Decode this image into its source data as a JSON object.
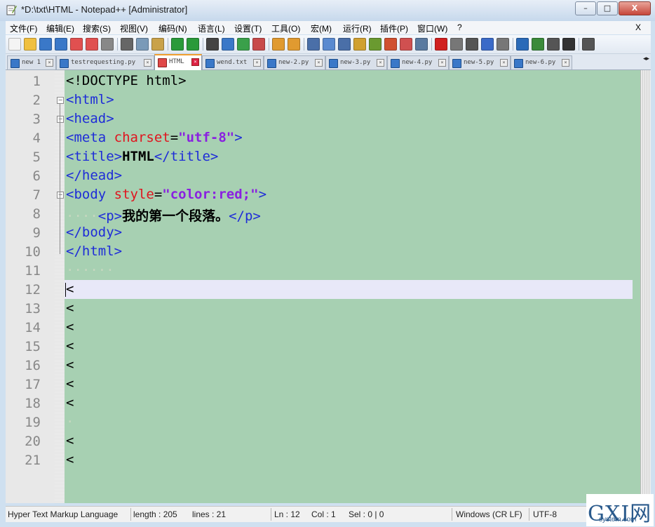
{
  "window": {
    "title": "*D:\\txt\\HTML - Notepad++ [Administrator]",
    "min_label": "–",
    "max_label": "□",
    "close_label": "X"
  },
  "menu": [
    "文件(F)",
    "编辑(E)",
    "搜索(S)",
    "视图(V)",
    "编码(N)",
    "语言(L)",
    "设置(T)",
    "工具(O)",
    "宏(M)",
    "运行(R)",
    "插件(P)",
    "窗口(W)",
    "?"
  ],
  "menu_close": "X",
  "toolbar_icons": [
    "new-file-icon",
    "open-file-icon",
    "save-icon",
    "save-all-icon",
    "close-icon",
    "close-all-icon",
    "print-icon",
    "cut-icon",
    "copy-icon",
    "paste-icon",
    "undo-icon",
    "redo-icon",
    "find-icon",
    "replace-icon",
    "zoom-in-icon",
    "zoom-out-icon",
    "sync-v-icon",
    "sync-h-icon",
    "wrap-icon",
    "show-all-chars-icon",
    "indent-guide-icon",
    "doc-map-icon",
    "function-list-icon",
    "folder-workspace-icon",
    "monitor-icon",
    "eye-icon",
    "record-macro-icon",
    "stop-macro-icon",
    "play-macro-icon",
    "run-macro-multiple-icon",
    "save-macro-icon",
    "download-icon",
    "list-icon",
    "list-alt-icon",
    "triangle-icon",
    "up-icon"
  ],
  "tabs": [
    {
      "label": "new 1",
      "active": false
    },
    {
      "label": "testrequesting.py",
      "active": false
    },
    {
      "label": "HTML",
      "active": true
    },
    {
      "label": "wend.txt",
      "active": false
    },
    {
      "label": "new-2.py",
      "active": false
    },
    {
      "label": "new-3.py",
      "active": false
    },
    {
      "label": "new-4.py",
      "active": false
    },
    {
      "label": "new-5.py",
      "active": false
    },
    {
      "label": "new-6.py",
      "active": false
    }
  ],
  "tab_scroll_label": "◂▸",
  "editor": {
    "current_line": 12,
    "lines": [
      {
        "n": "1",
        "tokens": [
          {
            "c": "plain",
            "t": "<!DOCTYPE html>"
          }
        ]
      },
      {
        "n": "2",
        "tokens": [
          {
            "c": "tag",
            "t": "<html>"
          }
        ]
      },
      {
        "n": "3",
        "tokens": [
          {
            "c": "tag",
            "t": "<head>"
          }
        ]
      },
      {
        "n": "4",
        "tokens": [
          {
            "c": "tag",
            "t": "<meta "
          },
          {
            "c": "attr",
            "t": "charset"
          },
          {
            "c": "plain",
            "t": "="
          },
          {
            "c": "val",
            "t": "\"utf-8\""
          },
          {
            "c": "tag",
            "t": ">"
          }
        ]
      },
      {
        "n": "5",
        "tokens": [
          {
            "c": "tag",
            "t": "<title>"
          },
          {
            "c": "txt",
            "t": "HTML"
          },
          {
            "c": "tag",
            "t": "</title>"
          }
        ]
      },
      {
        "n": "6",
        "tokens": [
          {
            "c": "tag",
            "t": "</head>"
          }
        ]
      },
      {
        "n": "7",
        "tokens": [
          {
            "c": "tag",
            "t": "<body "
          },
          {
            "c": "attr",
            "t": "style"
          },
          {
            "c": "plain",
            "t": "="
          },
          {
            "c": "val",
            "t": "\"color:red;\""
          },
          {
            "c": "tag",
            "t": ">"
          }
        ]
      },
      {
        "n": "8",
        "tokens": [
          {
            "c": "ws",
            "t": "····"
          },
          {
            "c": "tag",
            "t": "<p>"
          },
          {
            "c": "txt",
            "t": "我的第一个段落。"
          },
          {
            "c": "tag",
            "t": "</p>"
          }
        ]
      },
      {
        "n": "9",
        "tokens": [
          {
            "c": "tag",
            "t": "</body>"
          }
        ]
      },
      {
        "n": "10",
        "tokens": [
          {
            "c": "tag",
            "t": "</html>"
          }
        ]
      },
      {
        "n": "11",
        "tokens": [
          {
            "c": "ws",
            "t": "······"
          }
        ]
      },
      {
        "n": "12",
        "tokens": [
          {
            "c": "plain",
            "t": "<"
          }
        ]
      },
      {
        "n": "13",
        "tokens": [
          {
            "c": "plain",
            "t": "<"
          }
        ]
      },
      {
        "n": "14",
        "tokens": [
          {
            "c": "plain",
            "t": "<"
          }
        ]
      },
      {
        "n": "15",
        "tokens": [
          {
            "c": "plain",
            "t": "<"
          }
        ]
      },
      {
        "n": "16",
        "tokens": [
          {
            "c": "plain",
            "t": "<"
          }
        ]
      },
      {
        "n": "17",
        "tokens": [
          {
            "c": "plain",
            "t": "<"
          }
        ]
      },
      {
        "n": "18",
        "tokens": [
          {
            "c": "plain",
            "t": "<"
          }
        ]
      },
      {
        "n": "19",
        "tokens": [
          {
            "c": "ws",
            "t": "·"
          }
        ]
      },
      {
        "n": "20",
        "tokens": [
          {
            "c": "plain",
            "t": "<"
          }
        ]
      },
      {
        "n": "21",
        "tokens": [
          {
            "c": "plain",
            "t": "<"
          }
        ]
      }
    ]
  },
  "status": {
    "language": "Hyper Text Markup Language",
    "length": "length : 205",
    "lines": "lines : 21",
    "ln": "Ln : 12",
    "col": "Col : 1",
    "sel": "Sel : 0 | 0",
    "eol": "Windows (CR LF)",
    "encoding": "UTF-8"
  },
  "watermark": {
    "logo": "GXI网",
    "url": "system.com"
  },
  "colors": {
    "editor_bg": "#a7d0b2",
    "tag": "#1e2cd8",
    "attr": "#e0141e",
    "value": "#8a20e0",
    "current_line": "#e8e8f8"
  }
}
